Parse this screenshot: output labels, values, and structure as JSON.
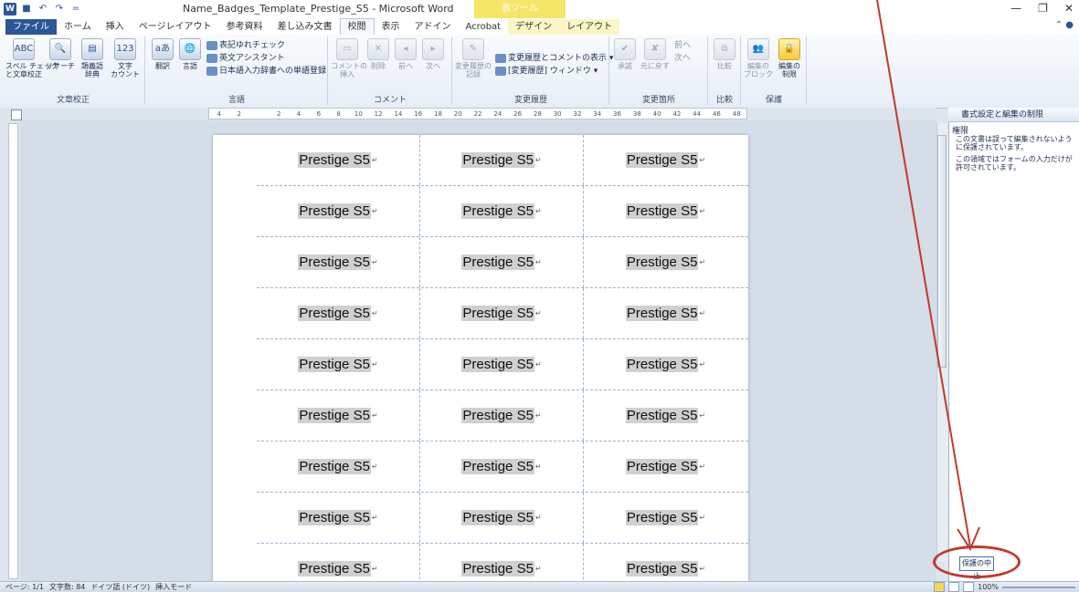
{
  "window": {
    "title": "Name_Badges_Template_Prestige_S5 - Microsoft Word",
    "contextual_group": "表ツール",
    "controls": [
      "—",
      "❐",
      "✕"
    ]
  },
  "qat": {
    "word_icon": "W",
    "save": "■",
    "undo": "↶",
    "redo": "↷",
    "customize": "="
  },
  "tabs": [
    "ファイル",
    "ホーム",
    "挿入",
    "ページレイアウト",
    "参考資料",
    "差し込み文書",
    "校閲",
    "表示",
    "アドイン",
    "Acrobat",
    "デザイン",
    "レイアウト"
  ],
  "active_tab": "校閲",
  "ribbon": {
    "proofing": {
      "label": "文章校正",
      "spell": "スペル チェック\nと文章校正",
      "research": "リサーチ",
      "thesaurus": "類義語\n辞典",
      "wordcount": "文字\nカウント"
    },
    "language": {
      "label": "言語",
      "translate": "翻訳",
      "language": "言語",
      "check_variation": "表記ゆれチェック",
      "english_assist": "英文アシスタント",
      "ime_dict": "日本語入力辞書への単語登録"
    },
    "comments": {
      "label": "コメント",
      "insert": "コメントの\n挿入",
      "delete": "削除",
      "prev": "前へ",
      "next": "次へ"
    },
    "tracking": {
      "label": "変更履歴",
      "track": "変更履歴の\n記録",
      "show_markup": "変更履歴とコメントの表示",
      "reviewing_pane": "[変更履歴] ウィンドウ"
    },
    "changes": {
      "label": "変更箇所",
      "accept": "承諾",
      "reject": "元に戻す",
      "prev": "前へ",
      "next": "次へ"
    },
    "compare": {
      "label": "比較",
      "compare": "比較"
    },
    "protect": {
      "label": "保護",
      "block_authors": "編集の\nブロック",
      "restrict_editing": "編集の\n制限"
    }
  },
  "ruler": [
    "4",
    "2",
    "",
    "2",
    "4",
    "6",
    "8",
    "10",
    "12",
    "14",
    "16",
    "18",
    "20",
    "22",
    "24",
    "26",
    "28",
    "30",
    "32",
    "34",
    "36",
    "38",
    "40",
    "42",
    "44",
    "46",
    "48"
  ],
  "badges": {
    "text": "Prestige S5",
    "rows": 9,
    "cols": 3
  },
  "pane": {
    "title": "書式設定と編集の制限",
    "section": "権限",
    "msg1": "この文書は誤って編集されないように保護されています。",
    "msg2": "この領域ではフォームの入力だけが許可されています。",
    "stop_button": "保護の中止"
  },
  "status": {
    "page": "ページ: 1/1",
    "words": "文字数: 84",
    "language": "ドイツ語 (ドイツ)",
    "mode": "挿入モード",
    "zoom": "100%"
  },
  "annotation_color": "#c0392b"
}
